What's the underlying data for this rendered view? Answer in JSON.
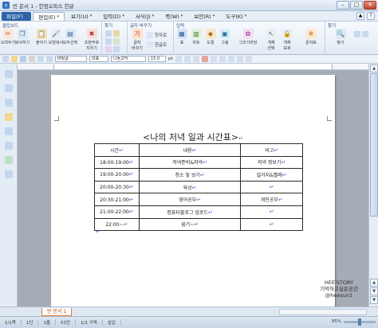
{
  "window": {
    "title": "빈 문서 1 - 한컴오피스 한글"
  },
  "menu": {
    "items": [
      "파일(F)",
      "편집(E)",
      "보기(U)",
      "입력(D)",
      "서식(J)",
      "쪽(W)",
      "보안(R)",
      "도구(K)"
    ]
  },
  "ribbon": {
    "clipboard": {
      "label": "클립보드",
      "cut": "오려두기",
      "copy": "복사하기",
      "paste": "붙이기",
      "paste_sub": "모양복사",
      "select_all": "모두선택",
      "condition": "조판부호",
      "condition_sub": "지우기"
    },
    "ruler_group": {
      "label": "찾기"
    },
    "font_group": {
      "label": "글자 바꾸기",
      "glyph_btn": "글자",
      "glyph_btn_sub": "바꾸기",
      "hanja": "한자로",
      "hangul": "한글로"
    },
    "insert_group": {
      "label": "입력",
      "table": "표",
      "chart": "차트",
      "shape": "도형",
      "picture": "그림",
      "gallery": "그리기마당",
      "object": "개체",
      "object_sub": "선택",
      "object_prop": "개체",
      "object_prop_sub": "보호",
      "char": "문자표"
    },
    "find_group": {
      "label": "찾기",
      "find": "찾기"
    }
  },
  "format_bar": {
    "style": "바탕글",
    "lang": "대표",
    "font": "나눔고딕",
    "size": "15.0",
    "unit": "pt"
  },
  "document": {
    "title": "<나의 저녁 일과 시간표>",
    "table": {
      "header": [
        "시간",
        "내용",
        "비고"
      ],
      "rows": [
        [
          "18:00-19:00",
          "저녁준비&저녁",
          "저녁 정보기"
        ],
        [
          "19:00-20:00",
          "청소 및 씻기",
          "설거지&빨래"
        ],
        [
          "20:00-20:30",
          "육상",
          ""
        ],
        [
          "20:30-21:00",
          "영어공부",
          "개인공부"
        ],
        [
          "21:00-22:00",
          "컴퓨터블로그 업로드",
          ""
        ],
        [
          "22:00~",
          "쉼기~",
          ""
        ]
      ]
    }
  },
  "tabbar": {
    "tab": "빈 문서 1"
  },
  "status": {
    "page": "1/1쪽",
    "section": "1단",
    "line": "1줄",
    "col": "53칸",
    "section_count": "1/1 구역",
    "mode": "삽입",
    "zoom": "95%"
  },
  "watermark": {
    "line1": "HEE'STORY",
    "line2": "기억하고싶은공간",
    "line3": "@heesun1"
  },
  "colors": {
    "file_menu": "#2d63a8",
    "accent": "#4a72c4",
    "tab_border": "#e07b3a"
  }
}
